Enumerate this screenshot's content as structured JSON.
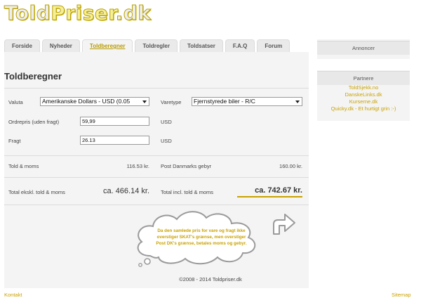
{
  "logo": {
    "part1": "Told",
    "part2": "Priser",
    "part3": ".dk"
  },
  "nav": {
    "tabs": [
      {
        "label": "Forside"
      },
      {
        "label": "Nyheder"
      },
      {
        "label": "Toldberegner"
      },
      {
        "label": "Toldregler"
      },
      {
        "label": "Toldsatser"
      },
      {
        "label": "F.A.Q"
      },
      {
        "label": "Forum"
      }
    ],
    "active": "Toldberegner"
  },
  "page": {
    "title": "Toldberegner"
  },
  "form": {
    "valuta_label": "Valuta",
    "valuta_value": "Amerikanske Dollars - USD (0.05",
    "varetype_label": "Varetype",
    "varetype_value": "Fjernstyrede biler - R/C",
    "ordrepris_label": "Ordrepris (uden fragt)",
    "ordrepris_value": "59,99",
    "ordrepris_unit": "USD",
    "fragt_label": "Fragt",
    "fragt_value": "26.13",
    "fragt_unit": "USD"
  },
  "results": {
    "told_moms_label": "Told & moms",
    "told_moms_value": "116.53 kr.",
    "post_label": "Post Danmarks gebyr",
    "post_value": "160.00 kr.",
    "total_excl_label": "Total ekskl. told & moms",
    "total_excl_value": "ca. 466.14 kr.",
    "total_incl_label": "Total incl. told & moms",
    "total_incl_value": "ca. 742.67 kr."
  },
  "cloud": {
    "line1": "Da den samlede pris for vare og fragt ikke",
    "line2": "overstiger SKAT's grænse, men overstiger",
    "line3": "Post DK's grænse, betales moms og gebyr."
  },
  "footer": {
    "copyright": "©2008 - 2014 Toldpriser.dk",
    "kontakt": "Kontakt",
    "sitemap": "Sitemap"
  },
  "sidebar": {
    "ads_title": "Annoncer",
    "partners_title": "Partnere",
    "partners": [
      "ToldSjekk.no",
      "DanskeLinks.dk",
      "Kurserne.dk",
      "Quicky.dk - Et hurtigt grin :-)"
    ]
  },
  "colors": {
    "accent": "#c9a200",
    "panel": "#f4f4f4",
    "tab": "#eaeaea"
  }
}
